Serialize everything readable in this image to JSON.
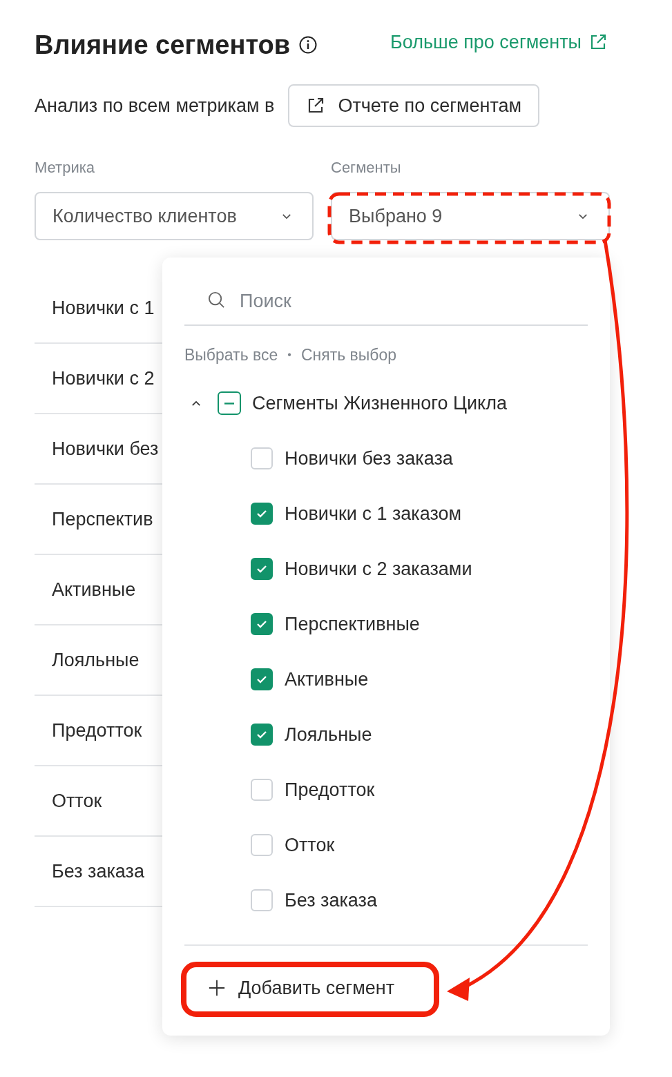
{
  "header": {
    "title": "Влияние сегментов",
    "link": "Больше про сегменты"
  },
  "analysis": {
    "text": "Анализ по всем метрикам в",
    "button": "Отчете по сегментам"
  },
  "filters": [
    {
      "label": "Метрика",
      "value": "Количество клиентов"
    },
    {
      "label": "Сегменты",
      "value": "Выбрано 9"
    }
  ],
  "segment_rows": [
    "Новички с 1",
    "Новички с 2",
    "Новички без",
    "Перспектив",
    "Активные",
    "Лояльные",
    "Предотток",
    "Отток",
    "Без заказа"
  ],
  "dropdown": {
    "search_placeholder": "Поиск",
    "select_all": "Выбрать все",
    "separator": "•",
    "clear": "Снять выбор",
    "group": {
      "label": "Сегменты Жизненного Цикла",
      "expanded": true,
      "indeterminate": true,
      "children": [
        {
          "label": "Новички без заказа",
          "checked": false
        },
        {
          "label": "Новички с 1 заказом",
          "checked": true
        },
        {
          "label": "Новички с 2 заказами",
          "checked": true
        },
        {
          "label": "Перспективные",
          "checked": true
        },
        {
          "label": "Активные",
          "checked": true
        },
        {
          "label": "Лояльные",
          "checked": true
        },
        {
          "label": "Предотток",
          "checked": false
        },
        {
          "label": "Отток",
          "checked": false
        },
        {
          "label": "Без заказа",
          "checked": false
        }
      ]
    },
    "add_button": "Добавить сегмент"
  }
}
